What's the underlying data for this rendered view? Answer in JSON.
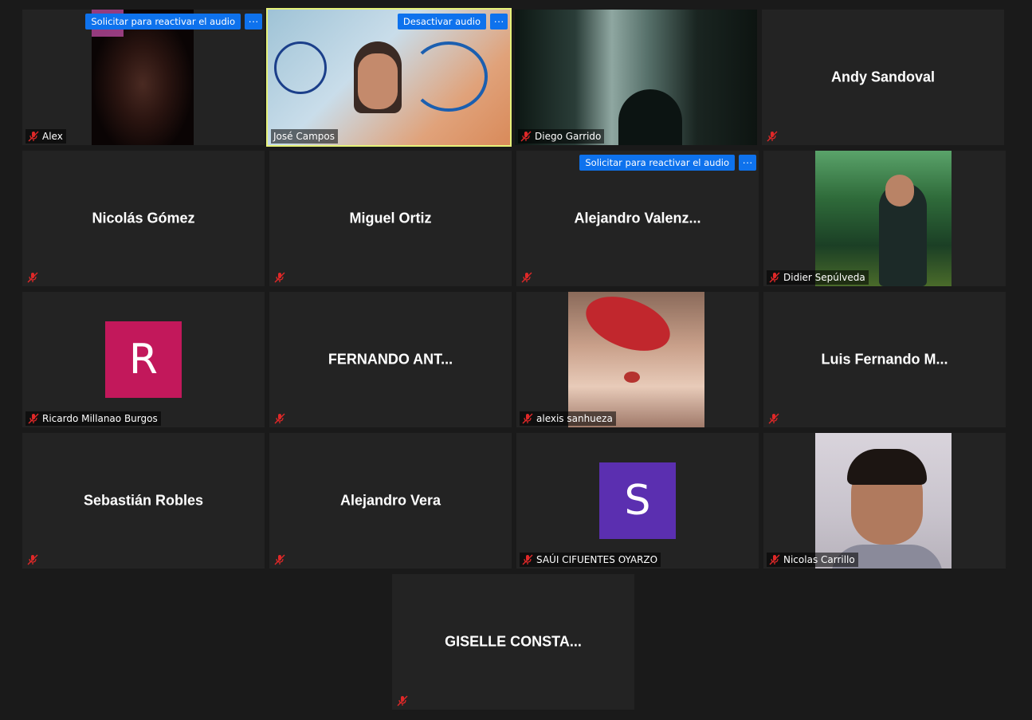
{
  "participants": [
    {
      "name": "Alex"
    },
    {
      "name": "José Campos"
    },
    {
      "name": "Diego Garrido"
    },
    {
      "name": "Andy Sandoval"
    },
    {
      "name": "Nicolás Gómez"
    },
    {
      "name": "Miguel Ortiz"
    },
    {
      "name": "Alejandro  Valenz..."
    },
    {
      "name": "Didier Sepúlveda"
    },
    {
      "name": "Ricardo Millanao Burgos",
      "initial": "R"
    },
    {
      "name": "FERNANDO  ANT..."
    },
    {
      "name": "alexis sanhueza"
    },
    {
      "name": "Luis  Fernando  M..."
    },
    {
      "name": "Sebastián Robles"
    },
    {
      "name": "Alejandro Vera"
    },
    {
      "name": "SAÚI CIFUENTES OYARZO",
      "initial": "S"
    },
    {
      "name": "Nicolas Carrillo"
    },
    {
      "name": "GISELLE  CONSTA..."
    }
  ],
  "actions": {
    "request_unmute": "Solicitar para reactivar el audio",
    "mute": "Desactivar audio",
    "more": "···"
  },
  "icons": {
    "muted": "mic-muted-icon"
  },
  "colors": {
    "accent": "#0e72ed",
    "speaking": "#e6f27a",
    "avatar_r": "#c2185b",
    "avatar_s": "#5b2fb0",
    "muted_red": "#e02828"
  }
}
